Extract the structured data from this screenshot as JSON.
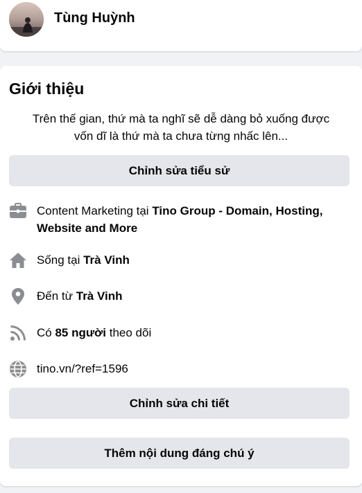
{
  "profile": {
    "name": "Tùng Huỳnh"
  },
  "intro": {
    "title": "Giới thiệu",
    "bio_line1": "Trên thế gian, thứ mà ta nghĩ sẽ dễ dàng bỏ xuống được",
    "bio_line2": "vốn dĩ là thứ mà ta chưa từng nhấc lên...",
    "edit_bio_label": "Chỉnh sửa tiểu sử",
    "work": {
      "prefix": "Content Marketing tại ",
      "place": "Tino Group - Domain, Hosting, Website and More",
      "icon": "briefcase-icon"
    },
    "lives": {
      "prefix": "Sống tại ",
      "place": "Trà Vinh",
      "icon": "home-icon"
    },
    "from": {
      "prefix": "Đến từ ",
      "place": "Trà Vinh",
      "icon": "location-pin-icon"
    },
    "followers": {
      "prefix": "Có ",
      "count": "85 người",
      "suffix": " theo dõi",
      "icon": "rss-icon"
    },
    "website": {
      "url": "tino.vn/?ref=1596",
      "icon": "globe-icon"
    },
    "edit_details_label": "Chỉnh sửa chi tiết",
    "add_featured_label": "Thêm nội dung đáng chú ý"
  },
  "colors": {
    "background": "#f0f2f5",
    "card": "#ffffff",
    "button": "#e4e6eb",
    "icon": "#8a8d91",
    "link": "#216fdb"
  }
}
